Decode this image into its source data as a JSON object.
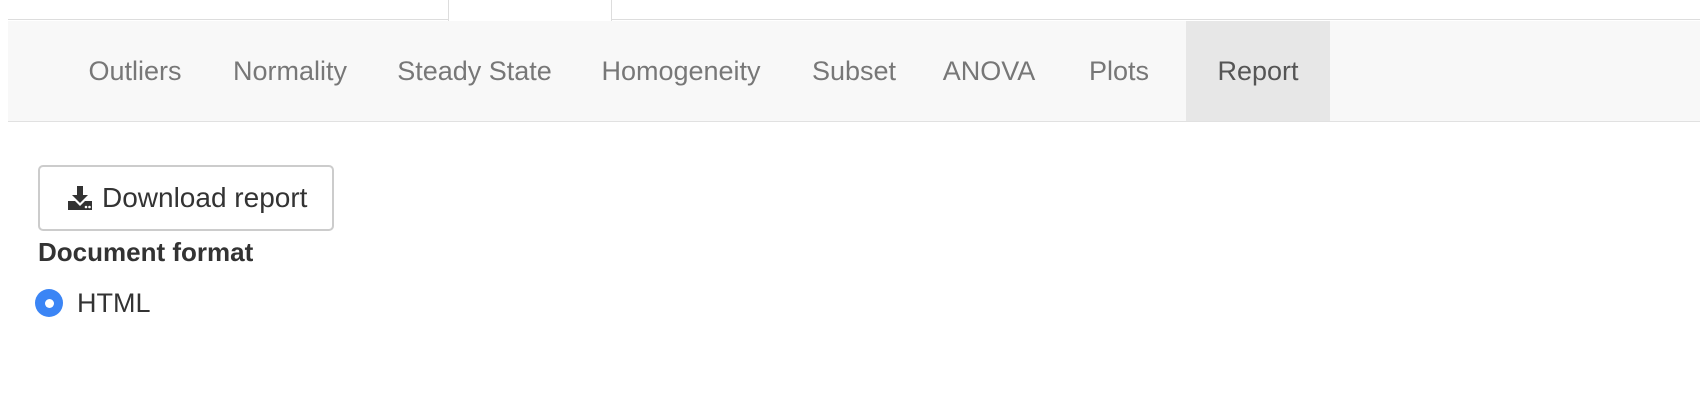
{
  "navbar": {
    "items": [
      {
        "label": "Outliers"
      },
      {
        "label": "Normality"
      },
      {
        "label": "Steady State"
      },
      {
        "label": "Homogeneity"
      },
      {
        "label": "Subset"
      },
      {
        "label": "ANOVA"
      },
      {
        "label": "Plots"
      },
      {
        "label": "Report",
        "active": true
      }
    ]
  },
  "report": {
    "download_label": "Download report",
    "download_icon": "download-icon",
    "format_label": "Document format",
    "format_options": [
      {
        "label": "HTML",
        "selected": true
      }
    ]
  },
  "colors": {
    "accent": "#3b85f5",
    "navbar_bg": "#f8f8f8",
    "active_tab_bg": "#e7e7e7"
  }
}
